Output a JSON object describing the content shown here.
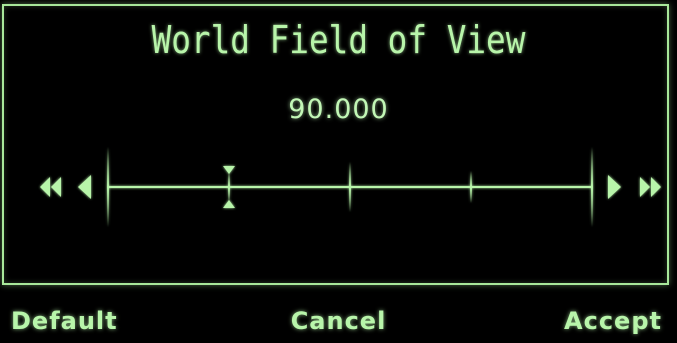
{
  "dialog": {
    "title": "World Field of View",
    "value_text": "90.000"
  },
  "slider": {
    "min": 0,
    "max": 360,
    "current": 90,
    "ticks": 5
  },
  "buttons": {
    "default_label": "Default",
    "cancel_label": "Cancel",
    "accept_label": "Accept"
  },
  "icons": {
    "fast_left": "double-left-arrow-icon",
    "left": "left-arrow-icon",
    "right": "right-arrow-icon",
    "fast_right": "double-right-arrow-icon",
    "marker": "slider-marker-icon"
  },
  "colors": {
    "accent": "#b8f5aa",
    "background": "#000000"
  }
}
